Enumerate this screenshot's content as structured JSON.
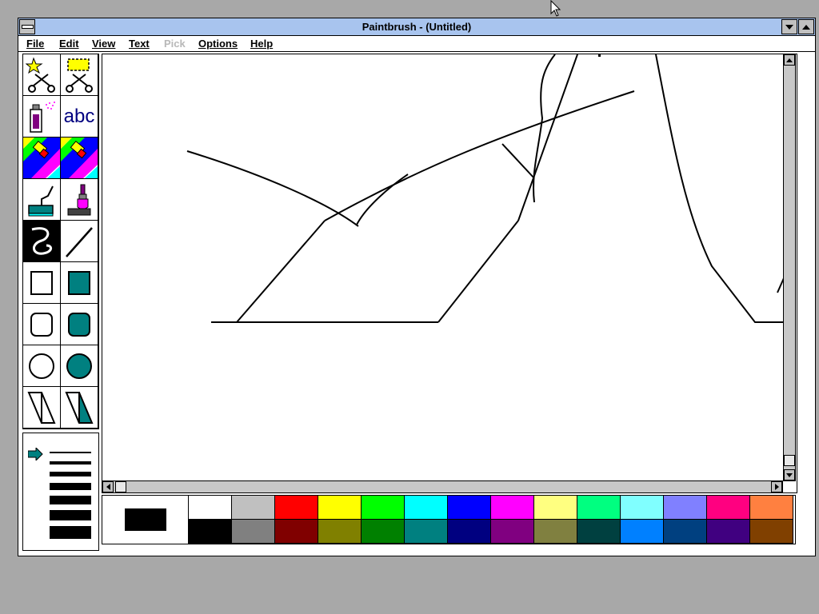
{
  "window": {
    "title": "Paintbrush - (Untitled)"
  },
  "menu": {
    "items": [
      {
        "label": "File",
        "enabled": true
      },
      {
        "label": "Edit",
        "enabled": true
      },
      {
        "label": "View",
        "enabled": true
      },
      {
        "label": "Text",
        "enabled": true
      },
      {
        "label": "Pick",
        "enabled": false
      },
      {
        "label": "Options",
        "enabled": true
      },
      {
        "label": "Help",
        "enabled": true
      }
    ]
  },
  "toolbox": {
    "text_tool_label": "abc",
    "selected_tool": "curve",
    "tools": [
      "scissors",
      "pick",
      "airbrush",
      "text",
      "color-eraser",
      "eraser",
      "paint-roller",
      "brush",
      "curve",
      "line",
      "box",
      "filled-box",
      "rounded-box",
      "filled-rounded-box",
      "circle",
      "filled-circle",
      "polygon",
      "filled-polygon"
    ]
  },
  "linesize": {
    "selected_index": 0
  },
  "colors": {
    "foreground": "#000000",
    "background": "#ffffff",
    "title_bar": "#a8c4ee",
    "palette": [
      "#ffffff",
      "#c0c0c0",
      "#ff0000",
      "#ffff00",
      "#00ff00",
      "#00ffff",
      "#0000ff",
      "#ff00ff",
      "#ffff80",
      "#00ff80",
      "#80ffff",
      "#8080ff",
      "#ff0080",
      "#ff8040",
      "#000000",
      "#808080",
      "#800000",
      "#808000",
      "#008000",
      "#008080",
      "#000080",
      "#800080",
      "#808040",
      "#004040",
      "#0080ff",
      "#004080",
      "#400080",
      "#804000"
    ]
  }
}
